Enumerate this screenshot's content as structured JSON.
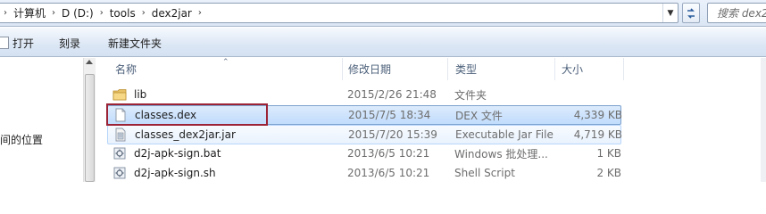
{
  "address": {
    "crumbs": [
      "计算机",
      "D (D:)",
      "tools",
      "dex2jar"
    ],
    "search_placeholder": "搜索 dex2j"
  },
  "toolbar": {
    "open_label": "打开",
    "burn_label": "刻录",
    "new_folder_label": "新建文件夹"
  },
  "nav": {
    "recent_label": "间的位置"
  },
  "columns": {
    "name": "名称",
    "date": "修改日期",
    "type": "类型",
    "size": "大小"
  },
  "files": [
    {
      "name": "lib",
      "date": "2015/2/26 21:48",
      "type": "文件夹",
      "size": "",
      "icon": "folder-icon",
      "state": "normal"
    },
    {
      "name": "classes.dex",
      "date": "2015/7/5 18:34",
      "type": "DEX 文件",
      "size": "4,339 KB",
      "icon": "file-icon",
      "state": "selected"
    },
    {
      "name": "classes_dex2jar.jar",
      "date": "2015/7/20 15:39",
      "type": "Executable Jar File",
      "size": "4,719 KB",
      "icon": "jar-file-icon",
      "state": "hover"
    },
    {
      "name": "d2j-apk-sign.bat",
      "date": "2013/6/5 10:21",
      "type": "Windows 批处理...",
      "size": "1 KB",
      "icon": "batch-file-icon",
      "state": "normal"
    },
    {
      "name": "d2j-apk-sign.sh",
      "date": "2013/6/5 10:21",
      "type": "Shell Script",
      "size": "2 KB",
      "icon": "script-file-icon",
      "state": "normal"
    }
  ],
  "colors": {
    "highlight_border": "#9b2335",
    "selection": "#c1dcfc"
  }
}
